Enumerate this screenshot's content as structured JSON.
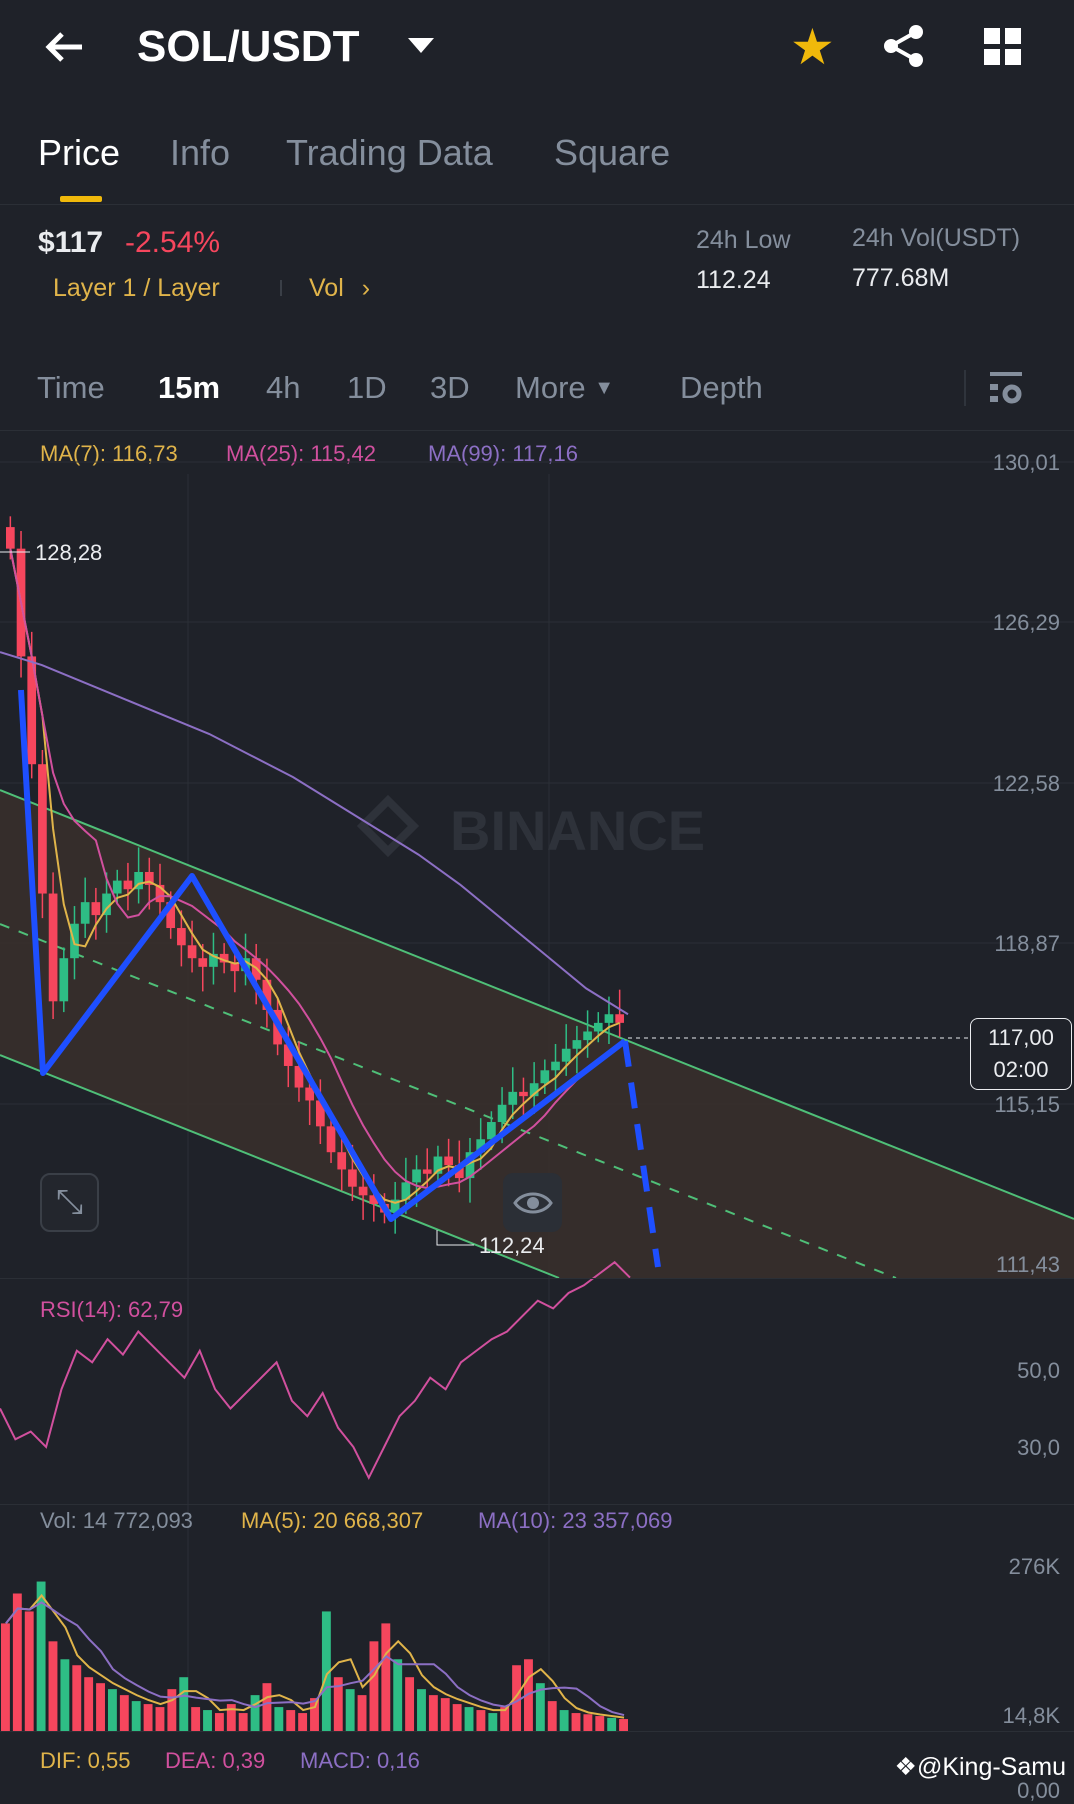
{
  "header": {
    "title": "SOL/USDT"
  },
  "tabs": [
    "Price",
    "Info",
    "Trading Data",
    "Square"
  ],
  "ticker": {
    "price": "$117",
    "change": "-2.54%",
    "category": "Layer 1 / Layer",
    "vol_link": "Vol",
    "low_label": "24h Low",
    "low_value": "112.24",
    "vol_label": "24h Vol(USDT)",
    "vol_value": "777.68M"
  },
  "timeframes": [
    "Time",
    "15m",
    "4h",
    "1D",
    "3D",
    "More",
    "Depth"
  ],
  "colors": {
    "up": "#2ebd85",
    "down": "#f6465d",
    "ma7": "#e0b44a",
    "ma25": "#d1509e",
    "ma99": "#8c6fc4",
    "accent": "#f0b90b",
    "pattern": "#1e4fff",
    "channel": "#4fbf78"
  },
  "legend": {
    "ma7": "MA(7): 116,73",
    "ma25": "MA(25): 115,42",
    "ma99": "MA(99): 117,16"
  },
  "price_axis": [
    "130,01",
    "126,29",
    "122,58",
    "118,87",
    "115,15",
    "111,43"
  ],
  "markers": {
    "high": "128,28",
    "low": "112,24",
    "current_price": "117,00",
    "countdown": "02:00"
  },
  "watermark": "BINANCE",
  "rsi": {
    "label": "RSI(14): 62,79",
    "axis": [
      "50,0",
      "30,0"
    ]
  },
  "volume": {
    "label": "Vol: 14 772,093",
    "ma5": "MA(5): 20 668,307",
    "ma10": "MA(10): 23 357,069",
    "axis": [
      "276K",
      "14,8K"
    ]
  },
  "macd": {
    "dif": "DIF: 0,55",
    "dea": "DEA: 0,39",
    "macd": "MACD: 0,16",
    "axis": "0,00"
  },
  "credit": "@King-Samu",
  "chart_data": {
    "type": "candlestick",
    "price_range": [
      111.43,
      130.01
    ],
    "closes": [
      128,
      125.5,
      123,
      120,
      117.5,
      118.5,
      119.3,
      119.8,
      119.5,
      120,
      120.3,
      120.1,
      120.5,
      120.2,
      119.8,
      119.2,
      118.8,
      118.5,
      118.3,
      118.6,
      118.4,
      118.2,
      118.5,
      118,
      117.3,
      116.5,
      116,
      115.5,
      115.2,
      114.6,
      114,
      113.6,
      113.2,
      113,
      112.8,
      112.6,
      112.9,
      113.3,
      113.6,
      113.5,
      113.9,
      113.7,
      113.4,
      114,
      114.3,
      114.7,
      115.1,
      115.4,
      115.3,
      115.6,
      115.9,
      116.1,
      116.4,
      116.6,
      116.8,
      117,
      117.2,
      117
    ],
    "ma99": [
      125.6,
      125.3,
      124.9,
      124.5,
      124.1,
      123.7,
      123.2,
      122.7,
      122.1,
      121.5,
      120.9,
      120.2,
      119.4,
      118.6,
      117.8,
      117.2
    ],
    "rsi": [
      40,
      32,
      34,
      30,
      45,
      55,
      52,
      58,
      54,
      60,
      56,
      52,
      48,
      55,
      45,
      40,
      44,
      48,
      52,
      42,
      38,
      44,
      35,
      30,
      22,
      30,
      38,
      42,
      48,
      45,
      52,
      55,
      58,
      60,
      64,
      68,
      66,
      70,
      72,
      75,
      78,
      74
    ],
    "volume": [
      180,
      230,
      200,
      250,
      150,
      120,
      110,
      90,
      80,
      70,
      60,
      50,
      45,
      40,
      70,
      90,
      40,
      35,
      30,
      45,
      30,
      60,
      80,
      40,
      35,
      30,
      55,
      200,
      90,
      70,
      60,
      150,
      180,
      120,
      90,
      70,
      60,
      55,
      45,
      40,
      35,
      30,
      40,
      110,
      120,
      80,
      50,
      35,
      30,
      28,
      25,
      22,
      20
    ]
  }
}
